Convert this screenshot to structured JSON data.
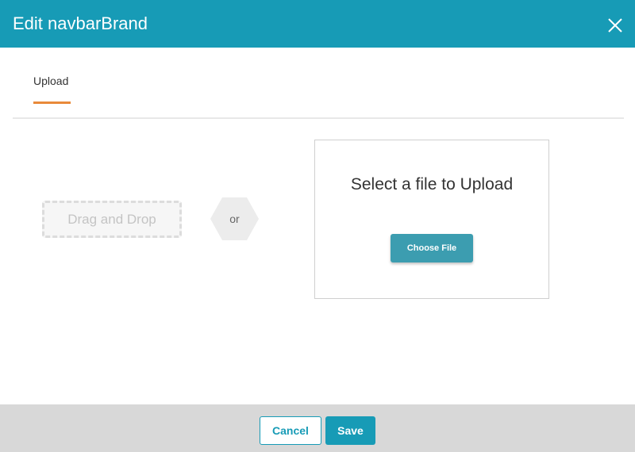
{
  "dialog": {
    "title": "Edit navbarBrand",
    "close_icon": "close-icon",
    "header_color": "#179bb6"
  },
  "tabs": [
    {
      "label": "Upload",
      "active": true
    }
  ],
  "accent_color": "#e98a3a",
  "upload": {
    "drag_drop_label": "Drag and Drop",
    "or_label": "or",
    "select_title": "Select a file to Upload",
    "choose_file_label": "Choose File"
  },
  "footer": {
    "cancel_label": "Cancel",
    "save_label": "Save"
  }
}
